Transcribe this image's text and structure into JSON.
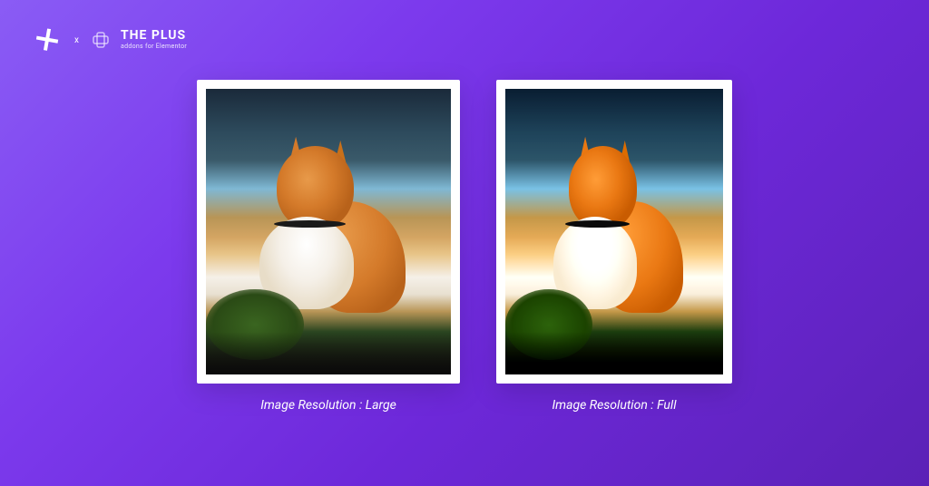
{
  "logo": {
    "primary_text": "THE PLUS",
    "secondary_text": "addons for Elementor",
    "separator": "x"
  },
  "images": [
    {
      "caption": "Image Resolution : Large",
      "variant": "large"
    },
    {
      "caption": "Image Resolution : Full",
      "variant": "full"
    }
  ]
}
